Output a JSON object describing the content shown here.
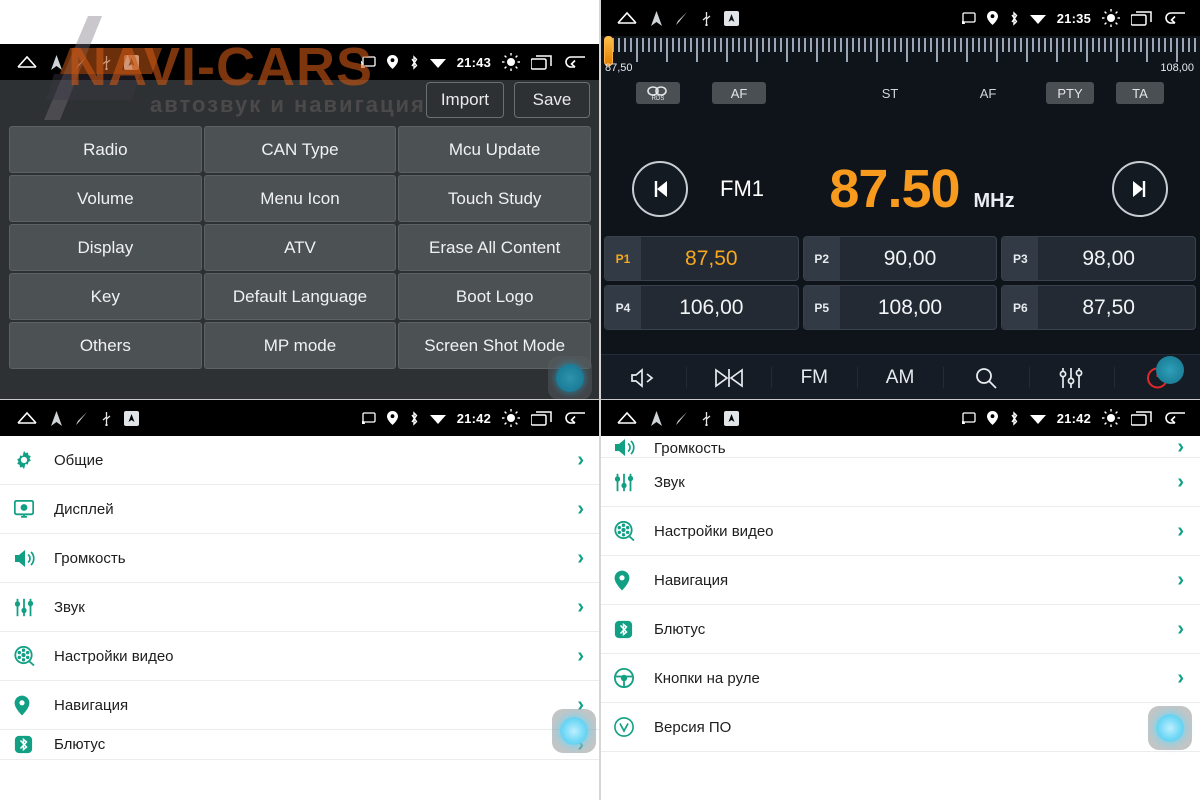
{
  "watermark": {
    "brand": "NAVI-CARS",
    "tagline": "автозвук и навигация"
  },
  "panels": {
    "factory_settings": {
      "status_bar": {
        "time": "21:43",
        "left_icons": [
          "home-icon",
          "navigation-arrow-icon",
          "pen-icon",
          "usb-icon",
          "maps-icon"
        ],
        "right_icons": [
          "cast-icon",
          "location-icon",
          "bluetooth-icon",
          "wifi-icon",
          "brightness-icon",
          "recents-icon",
          "back-icon"
        ]
      },
      "import_label": "Import",
      "save_label": "Save",
      "grid_items": [
        "Radio",
        "CAN Type",
        "Mcu Update",
        "Volume",
        "Menu Icon",
        "Touch Study",
        "Display",
        "ATV",
        "Erase All Content",
        "Key",
        "Default Language",
        "Boot Logo",
        "Others",
        "MP mode",
        "Screen Shot Mode"
      ]
    },
    "radio": {
      "status_bar": {
        "time": "21:35",
        "left_icons": [
          "home-icon",
          "navigation-arrow-icon",
          "pen-icon",
          "usb-icon",
          "maps-icon"
        ],
        "right_icons": [
          "cast-icon",
          "location-icon",
          "bluetooth-icon",
          "wifi-icon",
          "brightness-icon",
          "recents-icon",
          "back-icon"
        ]
      },
      "tuner": {
        "min_label": "87,50",
        "max_label": "108,00",
        "cursor_percent": 0
      },
      "rds_row": {
        "rds_chip": "RDS",
        "af_chip": "AF",
        "st_label": "ST",
        "af_label": "AF",
        "pty_chip": "PTY",
        "ta_chip": "TA"
      },
      "seek_prev_icon": "skip-previous-icon",
      "seek_next_icon": "skip-next-icon",
      "band": "FM1",
      "frequency": "87.50",
      "unit": "MHz",
      "presets": [
        {
          "tag": "P1",
          "value": "87,50",
          "active": true
        },
        {
          "tag": "P2",
          "value": "90,00",
          "active": false
        },
        {
          "tag": "P3",
          "value": "98,00",
          "active": false
        },
        {
          "tag": "P4",
          "value": "106,00",
          "active": false
        },
        {
          "tag": "P5",
          "value": "108,00",
          "active": false
        },
        {
          "tag": "P6",
          "value": "87,50",
          "active": false
        }
      ],
      "toolbar": [
        {
          "name": "mute-icon",
          "label": ""
        },
        {
          "name": "band-switch-icon",
          "label": ""
        },
        {
          "name": "fm-button",
          "label": "FM"
        },
        {
          "name": "am-button",
          "label": "AM"
        },
        {
          "name": "search-icon",
          "label": ""
        },
        {
          "name": "equalizer-icon",
          "label": ""
        },
        {
          "name": "power-icon",
          "label": ""
        }
      ]
    },
    "settings_top": {
      "status_bar": {
        "time": "21:42",
        "left_icons": [
          "home-icon",
          "navigation-arrow-icon",
          "pen-icon",
          "usb-icon",
          "maps-icon"
        ],
        "right_icons": [
          "cast-icon",
          "location-icon",
          "bluetooth-icon",
          "wifi-icon",
          "brightness-icon",
          "recents-icon",
          "back-icon"
        ]
      },
      "items": [
        {
          "icon": "gear-icon",
          "label": "Общие"
        },
        {
          "icon": "display-icon",
          "label": "Дисплей"
        },
        {
          "icon": "volume-icon",
          "label": "Громкость"
        },
        {
          "icon": "equalizer-icon",
          "label": "Звук"
        },
        {
          "icon": "video-reel-icon",
          "label": "Настройки видео"
        },
        {
          "icon": "location-pin-icon",
          "label": "Навигация"
        },
        {
          "icon": "bluetooth-icon",
          "label": "Блютус"
        }
      ]
    },
    "settings_scrolled": {
      "status_bar": {
        "time": "21:42",
        "left_icons": [
          "home-icon",
          "navigation-arrow-icon",
          "pen-icon",
          "usb-icon",
          "maps-icon"
        ],
        "right_icons": [
          "cast-icon",
          "location-icon",
          "bluetooth-icon",
          "wifi-icon",
          "brightness-icon",
          "recents-icon",
          "back-icon"
        ]
      },
      "items": [
        {
          "icon": "volume-icon",
          "label": "Громкость"
        },
        {
          "icon": "equalizer-icon",
          "label": "Звук"
        },
        {
          "icon": "video-reel-icon",
          "label": "Настройки видео"
        },
        {
          "icon": "location-pin-icon",
          "label": "Навигация"
        },
        {
          "icon": "bluetooth-icon",
          "label": "Блютус"
        },
        {
          "icon": "steering-wheel-icon",
          "label": "Кнопки на руле"
        },
        {
          "icon": "version-icon",
          "label": "Версия ПО"
        }
      ]
    }
  },
  "colors": {
    "accent_orange": "#f79a1e",
    "accent_teal": "#12a085",
    "dark_panel": "#2e3133",
    "radio_bg": "#0f141b",
    "touch_blue": "#6fd7f5"
  }
}
